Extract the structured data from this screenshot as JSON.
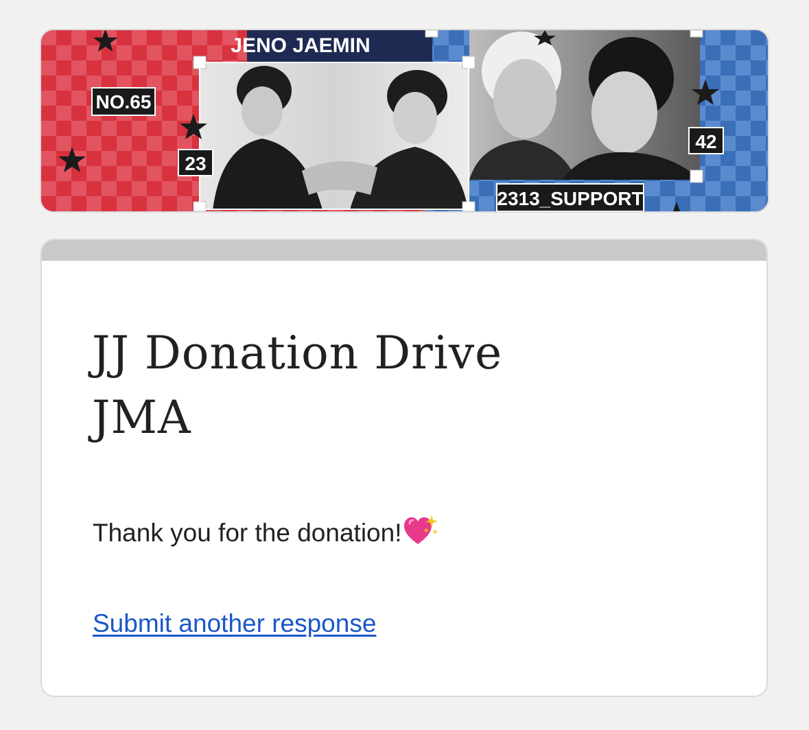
{
  "header_banner": {
    "title_tag": "JENO JAEMIN",
    "number_tag": "NO.65",
    "left_number": "23",
    "right_number": "42",
    "support_tag": "2313_SUPPORT",
    "colors": {
      "left_red": "#d8323f",
      "right_blue": "#3a6fb8",
      "label_bg": "#1a1a1a",
      "label_text": "#ffffff"
    }
  },
  "form": {
    "title_line1": "JJ Donation Drive",
    "title_line2": "JMA",
    "confirmation_message": "Thank you for the donation!",
    "message_icon": "sparkling-heart-icon",
    "submit_another_link": "Submit another response",
    "link_color": "#1a56c8",
    "topbar_color": "#c9c9c9"
  }
}
